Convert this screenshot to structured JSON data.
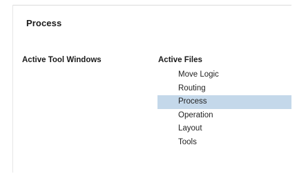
{
  "panel": {
    "title": "Process"
  },
  "tool_windows": {
    "heading": "Active Tool Windows"
  },
  "active_files": {
    "heading": "Active Files",
    "selected_index": 2,
    "items": [
      {
        "label": "Move Logic"
      },
      {
        "label": "Routing"
      },
      {
        "label": "Process"
      },
      {
        "label": "Operation"
      },
      {
        "label": "Layout"
      },
      {
        "label": "Tools"
      }
    ]
  },
  "colors": {
    "selection_background": "#c4d8ea",
    "text": "#1a1a1a",
    "background": "#ffffff"
  }
}
